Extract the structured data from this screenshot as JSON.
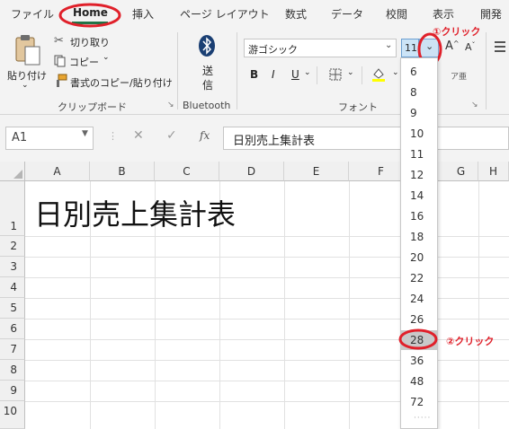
{
  "tabs": [
    {
      "label": "ファイル"
    },
    {
      "label": "Home"
    },
    {
      "label": "挿入"
    },
    {
      "label": "ページ レイアウト"
    },
    {
      "label": "数式"
    },
    {
      "label": "データ"
    },
    {
      "label": "校閲"
    },
    {
      "label": "表示"
    },
    {
      "label": "開発"
    }
  ],
  "clipboard": {
    "paste_label": "貼り付け",
    "cut_label": "切り取り",
    "copy_label": "コピー",
    "format_painter_label": "書式のコピー/貼り付け",
    "group_label": "クリップボード"
  },
  "bluetooth": {
    "send_label_line1": "送",
    "send_label_line2": "信",
    "group_label": "Bluetooth"
  },
  "font": {
    "name_value": "游ゴシック",
    "size_value": "11",
    "bold_label": "B",
    "italic_label": "I",
    "underline_label": "U",
    "increase_size_label": "A",
    "decrease_size_label": "A",
    "group_label": "フォント",
    "furigana_glyph": "ア亜"
  },
  "formula_bar": {
    "name_box_value": "A1",
    "fx_label": "fx",
    "formula_value": "日別売上集計表"
  },
  "grid": {
    "columns": [
      "A",
      "B",
      "C",
      "D",
      "E",
      "F",
      "G",
      "H"
    ],
    "rows": [
      "1",
      "2",
      "3",
      "4",
      "5",
      "6",
      "7",
      "8",
      "9",
      "10"
    ],
    "cell_a1": "日別売上集計表"
  },
  "font_size_dropdown": {
    "options": [
      "6",
      "8",
      "9",
      "10",
      "11",
      "12",
      "14",
      "16",
      "18",
      "20",
      "22",
      "24",
      "26",
      "28",
      "36",
      "48",
      "72"
    ],
    "highlighted": "28"
  },
  "annotations": {
    "step1": "①クリック",
    "step2": "②クリック"
  },
  "colors": {
    "excel_green": "#217346",
    "annotation_red": "#e0202a",
    "selection_blue": "#cce4f7",
    "highlight_gray": "#c9c9c9"
  }
}
